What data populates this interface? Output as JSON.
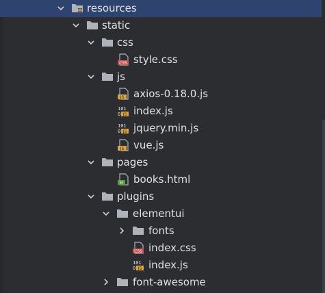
{
  "project_tree": {
    "items": [
      {
        "label": "resources",
        "icon": "resources-folder-icon",
        "expanded": true,
        "selected": true
      },
      {
        "label": "static",
        "icon": "folder-icon",
        "expanded": true
      },
      {
        "label": "css",
        "icon": "folder-icon",
        "expanded": true
      },
      {
        "label": "style.css",
        "icon": "css-file-icon",
        "badge": "CSS"
      },
      {
        "label": "js",
        "icon": "folder-icon",
        "expanded": true
      },
      {
        "label": "axios-0.18.0.js",
        "icon": "js-file-icon",
        "badge": "JS"
      },
      {
        "label": "index.js",
        "icon": "js-binary-file-icon",
        "badge": "JS"
      },
      {
        "label": "jquery.min.js",
        "icon": "js-binary-file-icon",
        "badge": "JS"
      },
      {
        "label": "vue.js",
        "icon": "js-file-icon",
        "badge": "JS"
      },
      {
        "label": "pages",
        "icon": "folder-icon",
        "expanded": true
      },
      {
        "label": "books.html",
        "icon": "html-file-icon",
        "badge": "H"
      },
      {
        "label": "plugins",
        "icon": "folder-icon",
        "expanded": true
      },
      {
        "label": "elementui",
        "icon": "folder-icon",
        "expanded": true
      },
      {
        "label": "fonts",
        "icon": "folder-icon",
        "expanded": false
      },
      {
        "label": "index.css",
        "icon": "css-file-icon",
        "badge": "CSS"
      },
      {
        "label": "index.js",
        "icon": "js-binary-file-icon",
        "badge": "JS"
      },
      {
        "label": "font-awesome",
        "icon": "folder-icon",
        "expanded": false
      }
    ]
  },
  "colors": {
    "background": "#2b2d30",
    "selection": "#2e436e",
    "text": "#dfe1e5",
    "folder": "#aeb3bb",
    "css_badge": "#c75450",
    "js_badge": "#d9a343",
    "html_badge": "#5a9e42"
  }
}
